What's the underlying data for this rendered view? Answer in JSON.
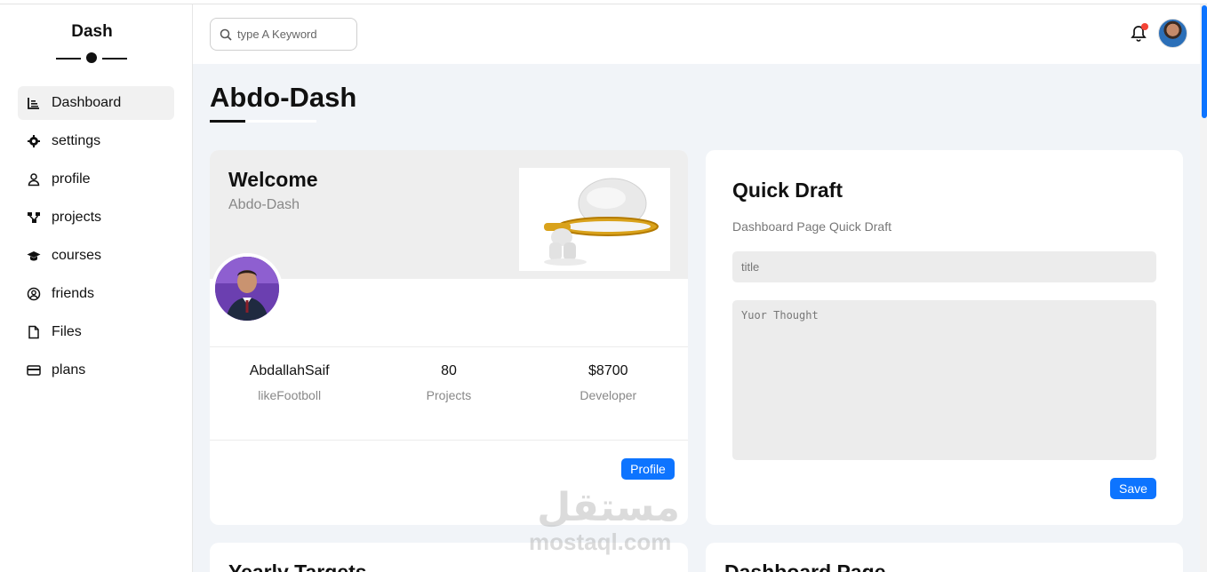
{
  "sidebar": {
    "brand": "Dash",
    "items": [
      {
        "label": "Dashboard",
        "icon": "chart-icon",
        "active": true
      },
      {
        "label": "settings",
        "icon": "gear-icon"
      },
      {
        "label": "profile",
        "icon": "user-icon"
      },
      {
        "label": "projects",
        "icon": "diagram-icon"
      },
      {
        "label": "courses",
        "icon": "graduation-cap-icon"
      },
      {
        "label": "friends",
        "icon": "user-circle-icon"
      },
      {
        "label": "Files",
        "icon": "file-icon"
      },
      {
        "label": "plans",
        "icon": "credit-card-icon"
      }
    ]
  },
  "header": {
    "search_placeholder": "type A Keyword",
    "notification_dot_color": "#f44336"
  },
  "page": {
    "title": "Abdo-Dash"
  },
  "welcome": {
    "title": "Welcome",
    "subtitle": "Abdo-Dash",
    "stats": [
      {
        "value": "AbdallahSaif",
        "label": "likeFootboll"
      },
      {
        "value": "80",
        "label": "Projects"
      },
      {
        "value": "$8700",
        "label": "Developer"
      }
    ],
    "profile_button": "Profile"
  },
  "draft": {
    "title": "Quick Draft",
    "subtitle": "Dashboard Page Quick Draft",
    "title_placeholder": "title",
    "text_placeholder": "Yuor Thought",
    "save_button": "Save"
  },
  "bottom": {
    "yearly_title": "Yearly Targets",
    "dashboard_title": "Dashboard Page"
  },
  "watermark": {
    "arabic": "مستقل",
    "latin": "mostaql.com"
  },
  "colors": {
    "accent": "#0d74ff",
    "background": "#f1f4f8"
  }
}
